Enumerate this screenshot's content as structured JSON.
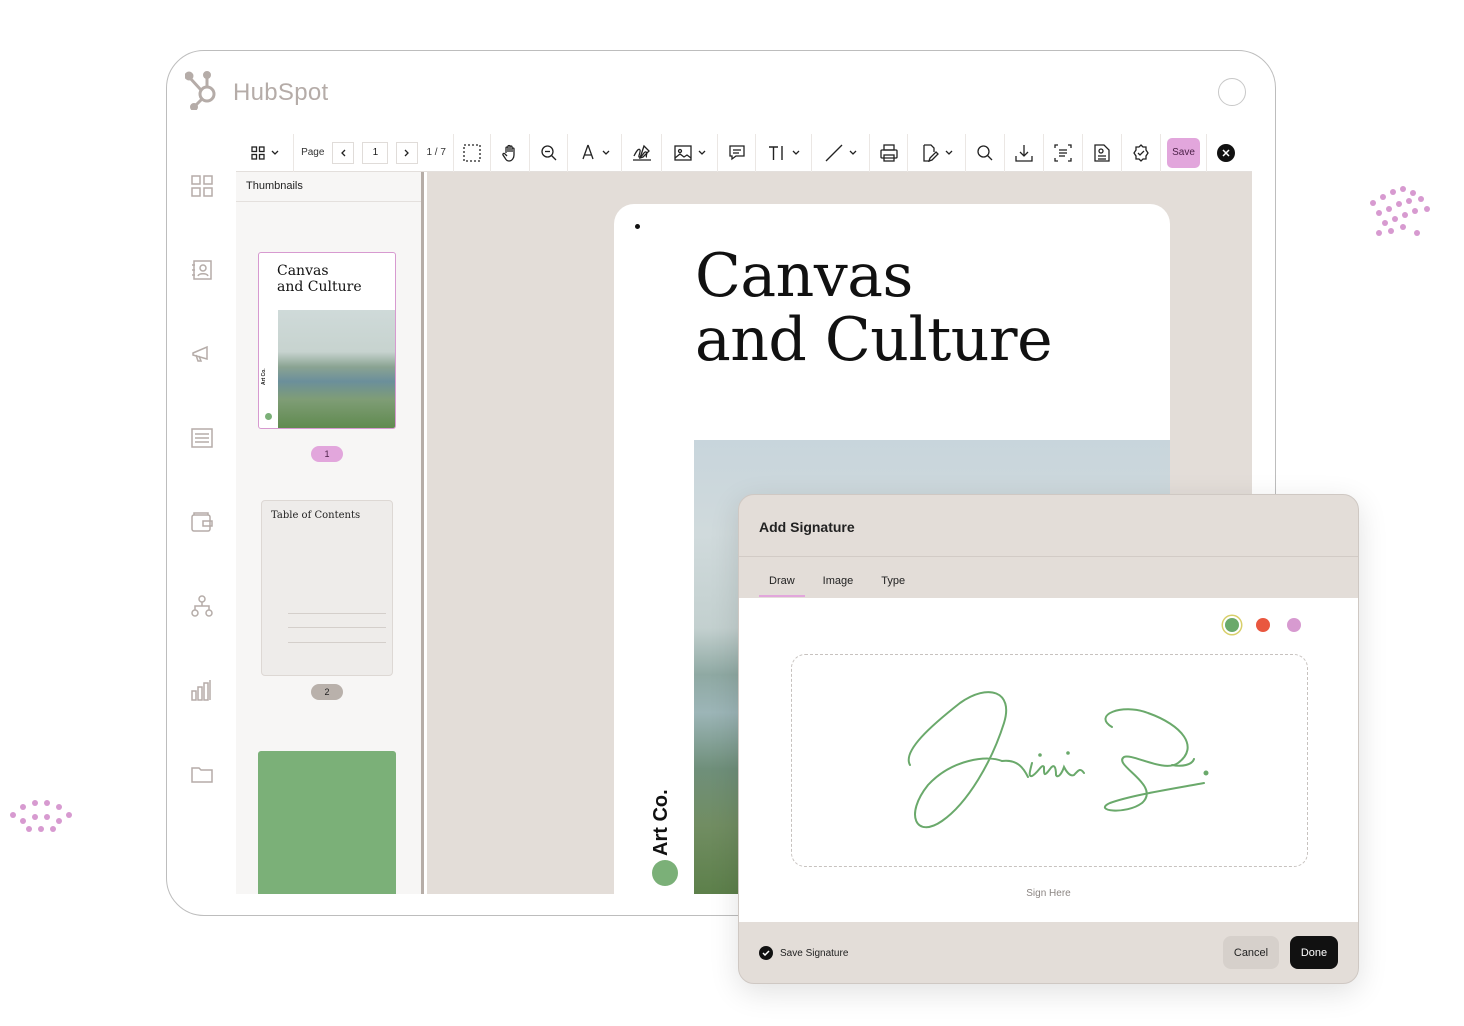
{
  "app": {
    "brand": "HubSpot"
  },
  "toolbar": {
    "page_label": "Page",
    "page_number": "1",
    "page_count": "1 / 7",
    "save_label": "Save"
  },
  "thumbnails": {
    "title": "Thumbnails",
    "items": [
      {
        "title_line1": "Canvas",
        "title_line2": "and Culture",
        "side_text": "Art Co.",
        "badge": "1"
      },
      {
        "title": "Table of Contents",
        "badge": "2"
      }
    ]
  },
  "document": {
    "title_line1": "Canvas",
    "title_line2": "and Culture",
    "brand": "Art Co."
  },
  "signature_modal": {
    "title": "Add Signature",
    "tabs": [
      "Draw",
      "Image",
      "Type"
    ],
    "active_tab": "Draw",
    "colors": [
      "#6aa96b",
      "#e9573f",
      "#d79ad0"
    ],
    "sign_here": "Sign Here",
    "save_signature_label": "Save Signature",
    "cancel_label": "Cancel",
    "done_label": "Done"
  }
}
